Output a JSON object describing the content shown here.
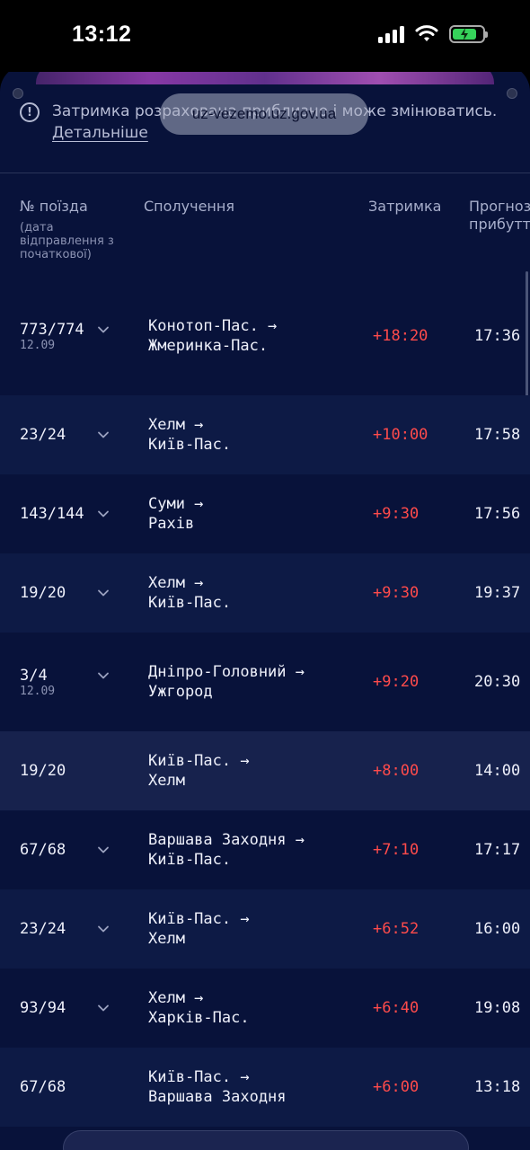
{
  "status": {
    "time": "13:12"
  },
  "browser": {
    "url": "uz-vezemo.uz.gov.ua"
  },
  "notice": {
    "text": "Затримка розрахована приблизно і може змінюватись.",
    "link": "Детальніше"
  },
  "columns": {
    "train": "№ поїзда",
    "train_sub": "(дата відправлення з початкової)",
    "route": "Сполучення",
    "delay": "Затримка",
    "forecast": "Прогноз прибуття"
  },
  "rows": [
    {
      "train": "773/774",
      "date": "12.09",
      "from": "Конотоп-Пас. →",
      "to": "Жмеринка-Пас.",
      "delay": "+18:20",
      "arrival": "17:36",
      "chevron": true
    },
    {
      "train": "23/24",
      "date": "",
      "from": "Хелм →",
      "to": "Київ-Пас.",
      "delay": "+10:00",
      "arrival": "17:58",
      "chevron": true
    },
    {
      "train": "143/144",
      "date": "",
      "from": "Суми →",
      "to": "Рахів",
      "delay": "+9:30",
      "arrival": "17:56",
      "chevron": true
    },
    {
      "train": "19/20",
      "date": "",
      "from": "Хелм →",
      "to": "Київ-Пас.",
      "delay": "+9:30",
      "arrival": "19:37",
      "chevron": true
    },
    {
      "train": "3/4",
      "date": "12.09",
      "from": "Дніпро-Головний →",
      "to": "Ужгород",
      "delay": "+9:20",
      "arrival": "20:30",
      "chevron": true
    },
    {
      "train": "19/20",
      "date": "",
      "from": "Київ-Пас. →",
      "to": "Хелм",
      "delay": "+8:00",
      "arrival": "14:00",
      "chevron": false
    },
    {
      "train": "67/68",
      "date": "",
      "from": "Варшава Заходня →",
      "to": "Київ-Пас.",
      "delay": "+7:10",
      "arrival": "17:17",
      "chevron": true
    },
    {
      "train": "23/24",
      "date": "",
      "from": "Київ-Пас. →",
      "to": "Хелм",
      "delay": "+6:52",
      "arrival": "16:00",
      "chevron": true
    },
    {
      "train": "93/94",
      "date": "",
      "from": "Хелм →",
      "to": "Харків-Пас.",
      "delay": "+6:40",
      "arrival": "19:08",
      "chevron": true
    },
    {
      "train": "67/68",
      "date": "",
      "from": "Київ-Пас. →",
      "to": "Варшава Заходня",
      "delay": "+6:00",
      "arrival": "13:18",
      "chevron": false
    }
  ]
}
